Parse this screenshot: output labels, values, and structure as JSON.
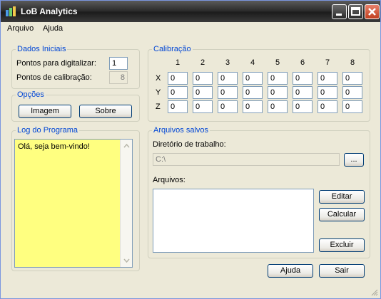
{
  "window": {
    "title": "LoB Analytics"
  },
  "menu": [
    "Arquivo",
    "Ajuda"
  ],
  "dados_iniciais": {
    "title": "Dados Iniciais",
    "pontos_digitalizar_label": "Pontos para digitalizar:",
    "pontos_digitalizar_value": "1",
    "pontos_calibracao_label": "Pontos de calibração:",
    "pontos_calibracao_value": "8"
  },
  "opcoes": {
    "title": "Opções",
    "imagem_label": "Imagem",
    "sobre_label": "Sobre"
  },
  "calibracao": {
    "title": "Calibração",
    "columns": [
      "1",
      "2",
      "3",
      "4",
      "5",
      "6",
      "7",
      "8"
    ],
    "rows": [
      {
        "label": "X",
        "values": [
          "0",
          "0",
          "0",
          "0",
          "0",
          "0",
          "0",
          "0"
        ]
      },
      {
        "label": "Y",
        "values": [
          "0",
          "0",
          "0",
          "0",
          "0",
          "0",
          "0",
          "0"
        ]
      },
      {
        "label": "Z",
        "values": [
          "0",
          "0",
          "0",
          "0",
          "0",
          "0",
          "0",
          "0"
        ]
      }
    ]
  },
  "log": {
    "title": "Log do Programa",
    "text": "Olá, seja bem-vindo!"
  },
  "arquivos_salvos": {
    "title": "Arquivos salvos",
    "diretorio_label": "Diretório de trabalho:",
    "diretorio_value": "C:\\",
    "browse_label": "...",
    "arquivos_label": "Arquivos:",
    "editar_label": "Editar",
    "calcular_label": "Calcular",
    "excluir_label": "Excluir"
  },
  "footer": {
    "ajuda_label": "Ajuda",
    "sair_label": "Sair"
  }
}
